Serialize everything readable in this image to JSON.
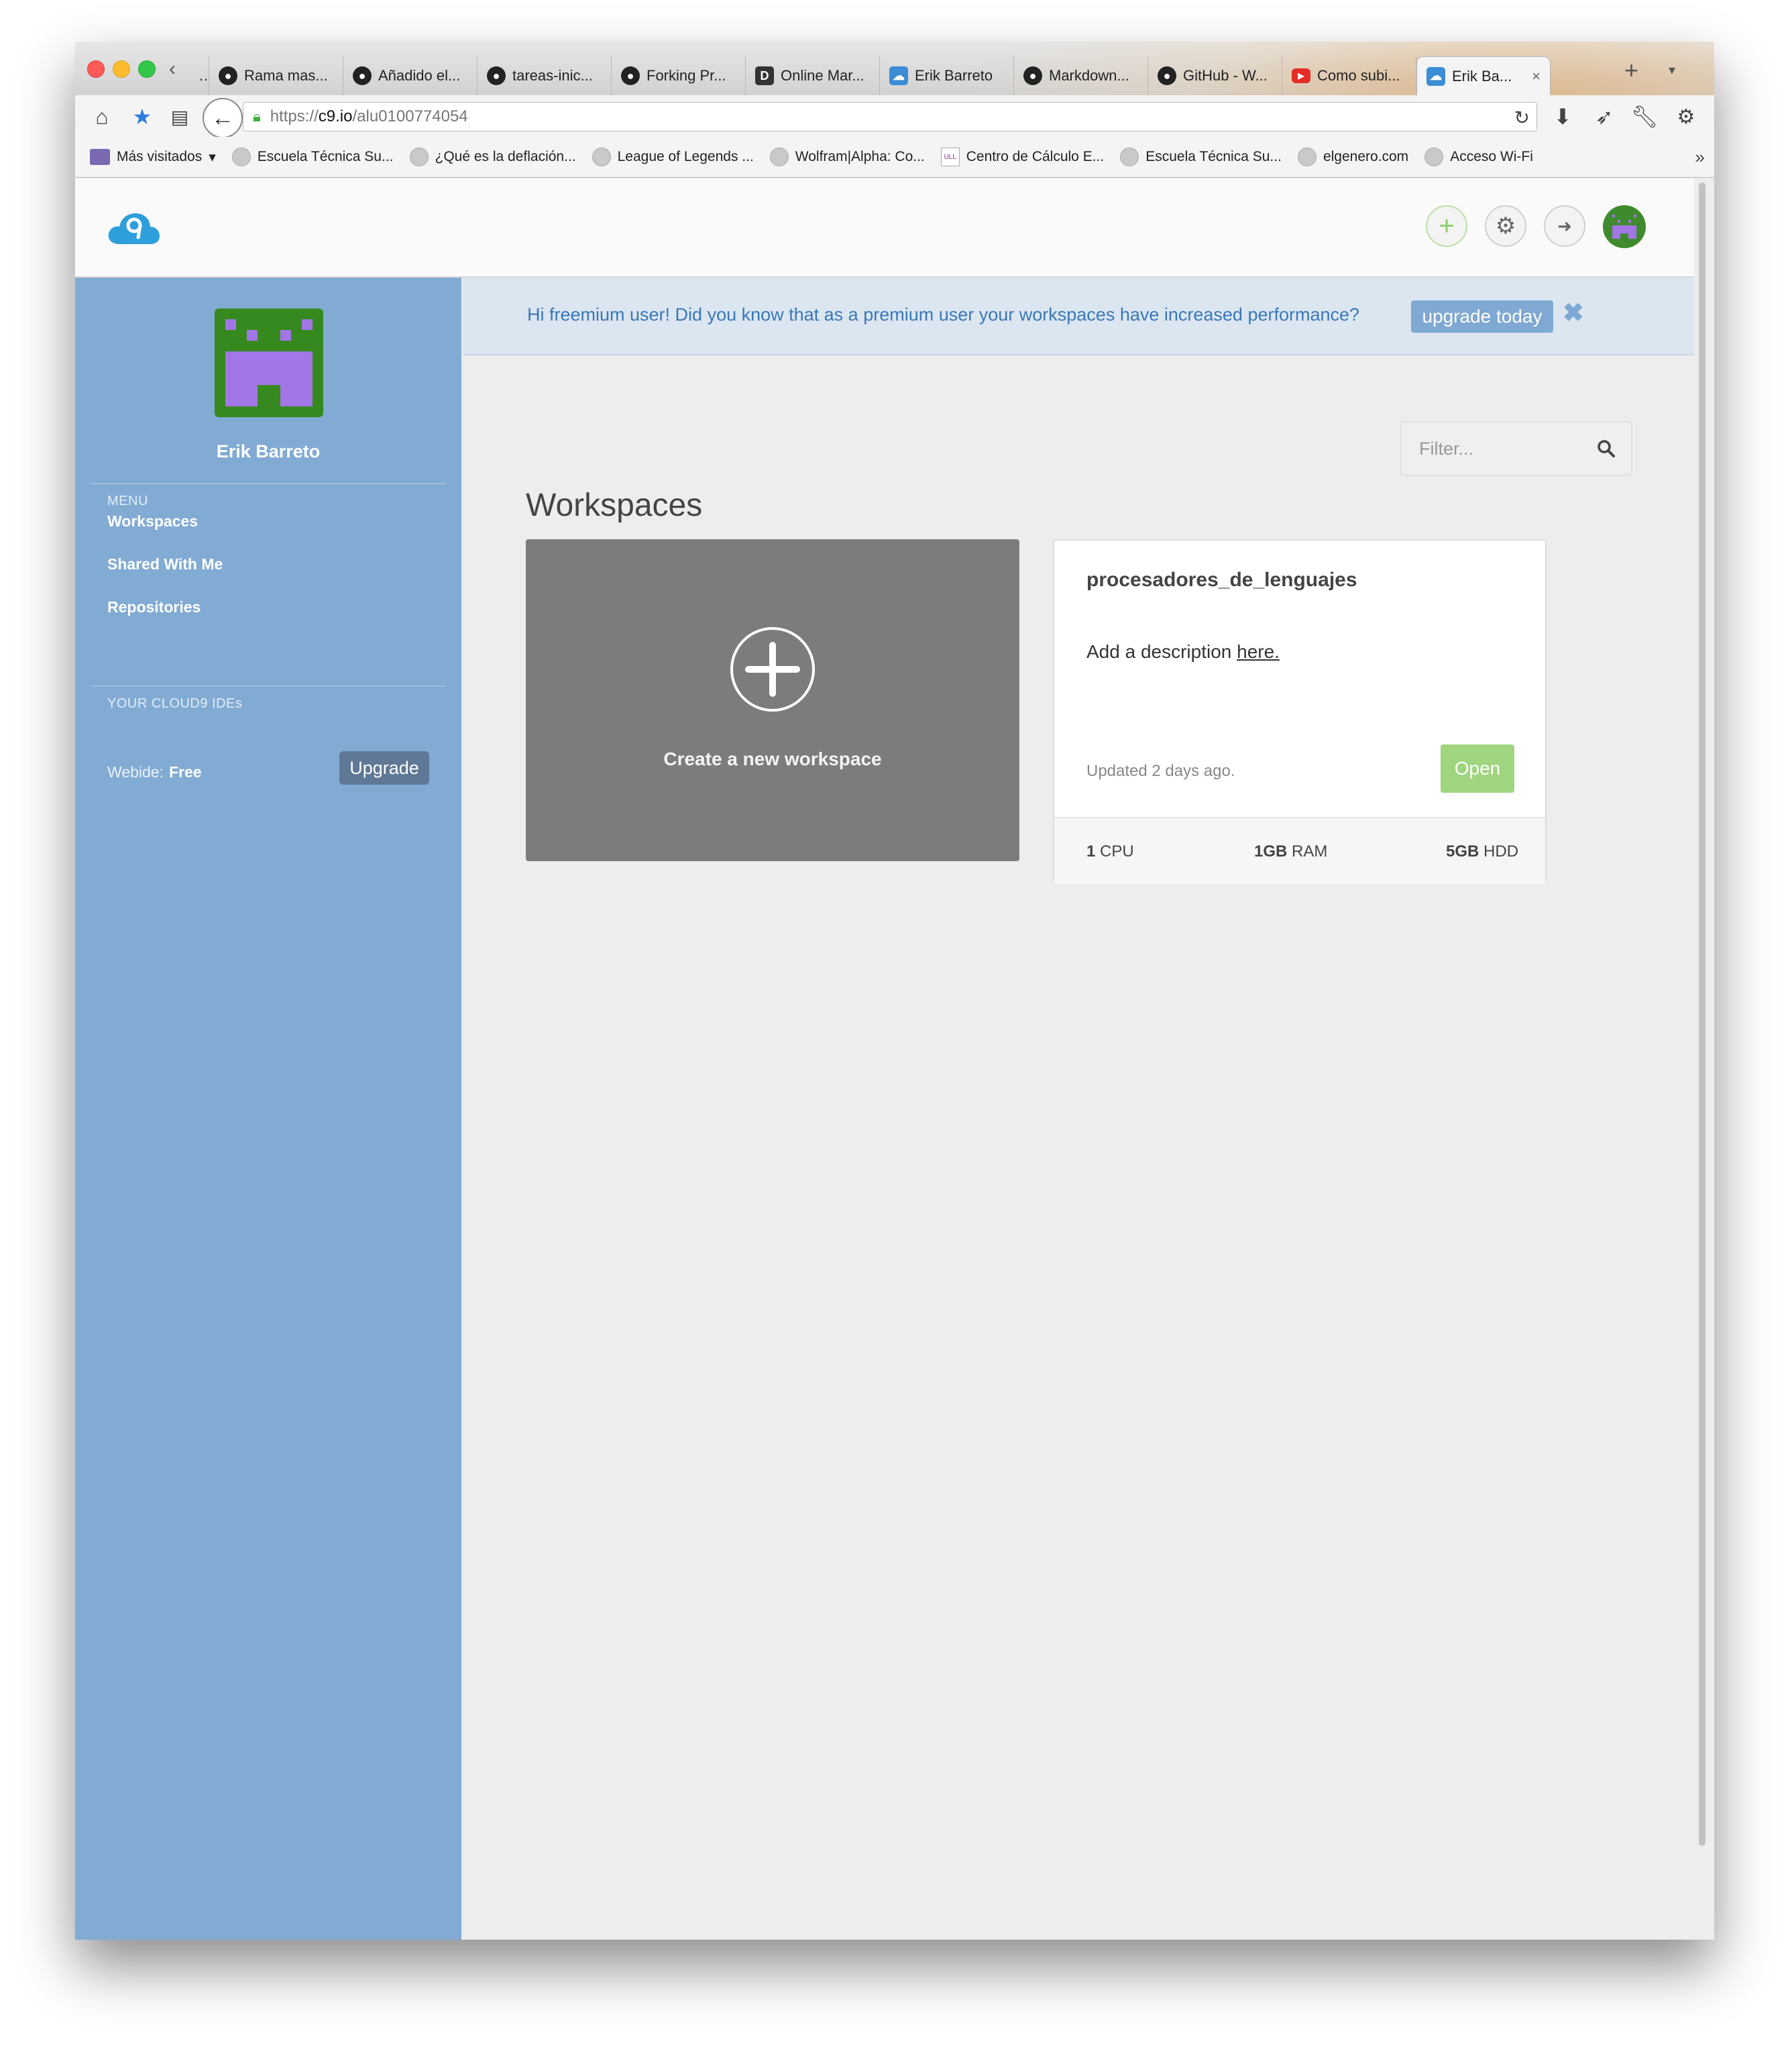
{
  "browser": {
    "tabs": [
      {
        "label": "",
        "icon": "partial-tab"
      },
      {
        "label": "Rama mas...",
        "icon": "github-icon"
      },
      {
        "label": "Añadido el...",
        "icon": "github-icon"
      },
      {
        "label": "tareas-inic...",
        "icon": "github-icon"
      },
      {
        "label": "Forking Pr...",
        "icon": "github-icon"
      },
      {
        "label": "Online Mar...",
        "icon": "dillinger-icon"
      },
      {
        "label": "Erik Barreto",
        "icon": "cloud9-icon"
      },
      {
        "label": "Markdown...",
        "icon": "github-icon"
      },
      {
        "label": "GitHub - W...",
        "icon": "github-icon"
      },
      {
        "label": "Como subi...",
        "icon": "youtube-icon"
      },
      {
        "label": "Erik Ba...",
        "icon": "cloud9-icon",
        "active": true
      }
    ],
    "url": {
      "scheme": "https://",
      "host": "c9.io",
      "path": "/alu0100774054"
    },
    "bookmarks": [
      "Más visitados",
      "Escuela Técnica Su...",
      "¿Qué es la deflación...",
      "League of Legends ...",
      "Wolfram|Alpha: Co...",
      "Centro de Cálculo E...",
      "Escuela Técnica Su...",
      "elgenero.com",
      "Acceso Wi-Fi"
    ]
  },
  "sidebar": {
    "user_name": "Erik Barreto",
    "menu_caption": "MENU",
    "menu_items": [
      "Workspaces",
      "Shared With Me",
      "Repositories"
    ],
    "ides_caption": "YOUR CLOUD9 IDEs",
    "plan_label": "Webide:",
    "plan_value": "Free",
    "upgrade_label": "Upgrade"
  },
  "banner": {
    "text": "Hi freemium user! Did you know that as a premium user your workspaces have increased performance?",
    "button": "upgrade today",
    "close": "✖"
  },
  "filter": {
    "placeholder": "Filter..."
  },
  "workspaces": {
    "title": "Workspaces",
    "create_label": "Create a new workspace",
    "items": [
      {
        "name": "procesadores_de_lenguajes",
        "desc_prefix": "Add a description ",
        "desc_link": "here.",
        "updated": "Updated 2 days ago.",
        "open_label": "Open",
        "cpu_value": "1",
        "cpu_unit": "CPU",
        "ram_value": "1GB",
        "ram_unit": "RAM",
        "hdd_value": "5GB",
        "hdd_unit": "HDD"
      }
    ]
  },
  "colors": {
    "sidebar": "#82abd3",
    "banner_bg": "#dbe6f1",
    "banner_text": "#3a78b8",
    "create_card": "#7c7c7c",
    "open_button": "#9fd57e",
    "avatar_green": "#36891f",
    "avatar_purple": "#a276e6"
  }
}
